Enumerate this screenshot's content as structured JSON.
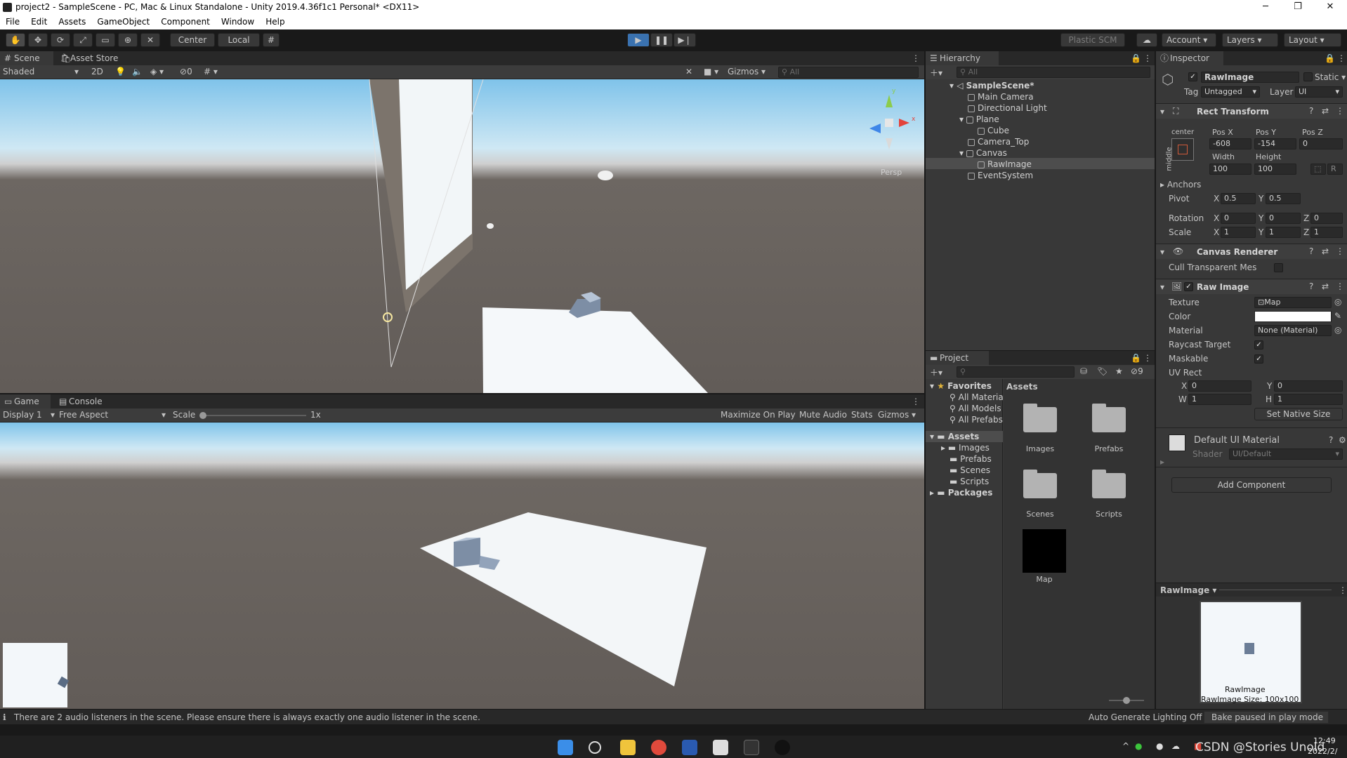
{
  "window": {
    "title": "project2 - SampleScene - PC, Mac & Linux Standalone - Unity 2019.4.36f1c1 Personal* <DX11>",
    "minimize": "─",
    "maximize": "❐",
    "close": "✕"
  },
  "menu": [
    "File",
    "Edit",
    "Assets",
    "GameObject",
    "Component",
    "Window",
    "Help"
  ],
  "toolbar": {
    "center": "Center",
    "local": "Local",
    "plastic": "Plastic SCM",
    "account": "Account",
    "layers": "Layers",
    "layout": "Layout"
  },
  "scene": {
    "tab_scene": "Scene",
    "tab_store": "Asset Store",
    "shading": "Shaded",
    "mode2d": "2D",
    "fx_count": "0",
    "gizmos": "Gizmos",
    "search_placeholder": "All",
    "persp": "Persp",
    "axis_y": "y",
    "axis_x": "x"
  },
  "game": {
    "tab_game": "Game",
    "tab_console": "Console",
    "display": "Display 1",
    "aspect": "Free Aspect",
    "scale_label": "Scale",
    "scale_value": "1x",
    "maximize": "Maximize On Play",
    "mute": "Mute Audio",
    "stats": "Stats",
    "gizmos": "Gizmos"
  },
  "hierarchy": {
    "title": "Hierarchy",
    "search_placeholder": "All",
    "items": [
      {
        "label": "SampleScene*",
        "depth": 0
      },
      {
        "label": "Main Camera",
        "depth": 1
      },
      {
        "label": "Directional Light",
        "depth": 1
      },
      {
        "label": "Plane",
        "depth": 1
      },
      {
        "label": "Cube",
        "depth": 2
      },
      {
        "label": "Camera_Top",
        "depth": 1
      },
      {
        "label": "Canvas",
        "depth": 1
      },
      {
        "label": "RawImage",
        "depth": 2
      },
      {
        "label": "EventSystem",
        "depth": 1
      }
    ]
  },
  "project": {
    "title": "Project",
    "hidden_count": "9",
    "favorites": "Favorites",
    "fav_items": [
      "All Materia",
      "All Models",
      "All Prefabs"
    ],
    "assets": "Assets",
    "asset_tree": [
      "Images",
      "Prefabs",
      "Scenes",
      "Scripts"
    ],
    "packages": "Packages",
    "breadcrumb": "Assets",
    "asset_items": [
      {
        "label": "Images"
      },
      {
        "label": "Prefabs"
      },
      {
        "label": "Scenes"
      },
      {
        "label": "Scripts"
      },
      {
        "label": "Map"
      }
    ]
  },
  "inspector": {
    "title": "Inspector",
    "object_name": "RawImage",
    "static": "Static",
    "tag_label": "Tag",
    "tag_value": "Untagged",
    "layer_label": "Layer",
    "layer_value": "UI",
    "rect_transform": "Rect Transform",
    "anchor_h": "center",
    "anchor_v": "middle",
    "posx_label": "Pos X",
    "posy_label": "Pos Y",
    "posz_label": "Pos Z",
    "posx": "-608",
    "posy": "-154",
    "posz": "0",
    "width_label": "Width",
    "height_label": "Height",
    "width": "100",
    "height": "100",
    "r_button": "R",
    "anchors": "Anchors",
    "pivot": "Pivot",
    "pivot_x": "0.5",
    "pivot_y": "0.5",
    "rotation": "Rotation",
    "rot_x": "0",
    "rot_y": "0",
    "rot_z": "0",
    "scale": "Scale",
    "scale_x": "1",
    "scale_y": "1",
    "scale_z": "1",
    "x": "X",
    "y": "Y",
    "z": "Z",
    "w": "W",
    "h": "H",
    "canvas_renderer": "Canvas Renderer",
    "cull": "Cull Transparent Mes",
    "raw_image": "Raw Image",
    "texture_label": "Texture",
    "texture": "Map",
    "color_label": "Color",
    "material_label": "Material",
    "material": "None (Material)",
    "raycast": "Raycast Target",
    "maskable": "Maskable",
    "uvrect": "UV Rect",
    "uv_x": "0",
    "uv_y": "0",
    "uv_w": "1",
    "uv_h": "1",
    "native_size": "Set Native Size",
    "default_mat": "Default UI Material",
    "shader_label": "Shader",
    "shader": "UI/Default",
    "add_component": "Add Component",
    "preview_title": "RawImage",
    "preview_name": "RawImage",
    "preview_size": "RawImage Size: 100x100"
  },
  "status": {
    "message": "There are 2 audio listeners in the scene. Please ensure there is always exactly one audio listener in the scene.",
    "auto_lighting": "Auto Generate Lighting Off",
    "bake": "Bake paused in play mode"
  },
  "taskbar": {
    "time": "12:49",
    "date": "2022/2/",
    "watermark": "CSDN @Stories Unold"
  }
}
